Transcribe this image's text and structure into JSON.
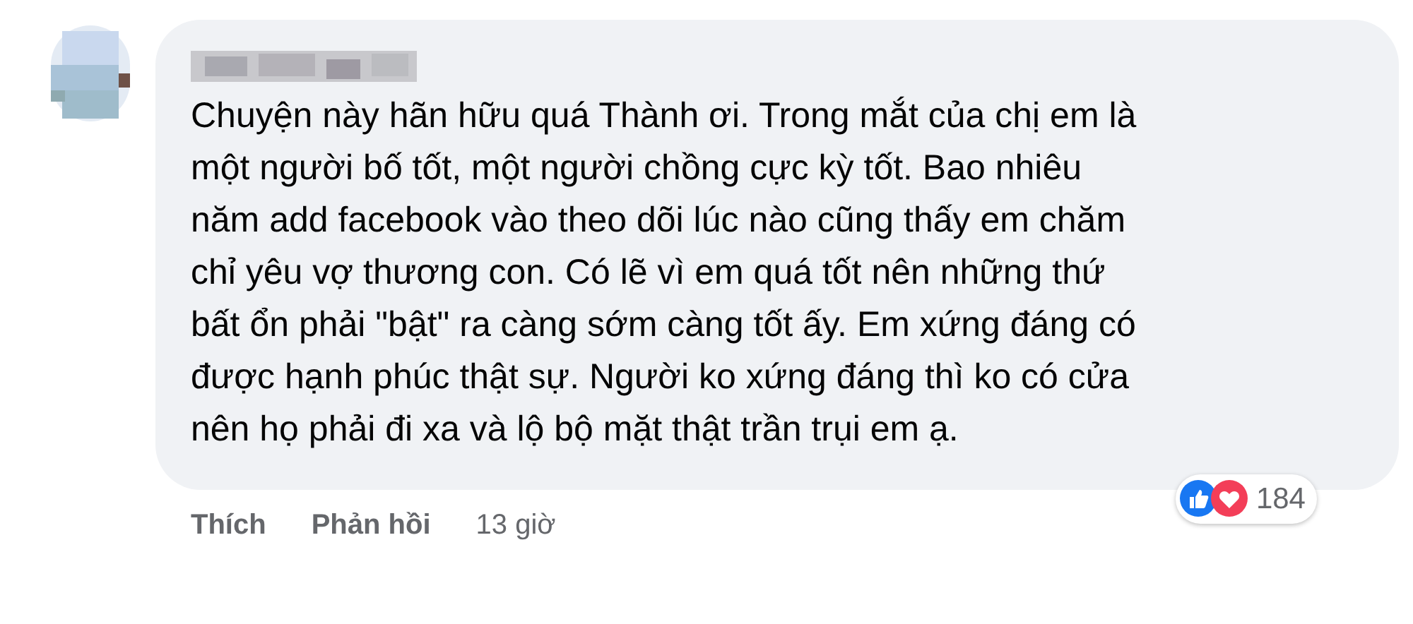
{
  "comment": {
    "text": "Chuyện này hãn hữu quá Thành ơi. Trong mắt của chị em là một người bố tốt, một người chồng cực kỳ tốt. Bao nhiêu năm add facebook vào theo dõi lúc nào cũng thấy em chăm chỉ yêu vợ thương con. Có lẽ vì em quá tốt nên những thứ bất ổn phải \"bật\" ra càng sớm càng tốt ấy. Em xứng đáng có được hạnh phúc thật sự. Người ko xứng đáng thì ko có cửa nên họ phải đi xa và lộ bộ mặt thật trần trụi em ạ.",
    "reaction_count": "184"
  },
  "actions": [
    "Thích",
    "Phản hồi"
  ],
  "time": "13 giờ"
}
